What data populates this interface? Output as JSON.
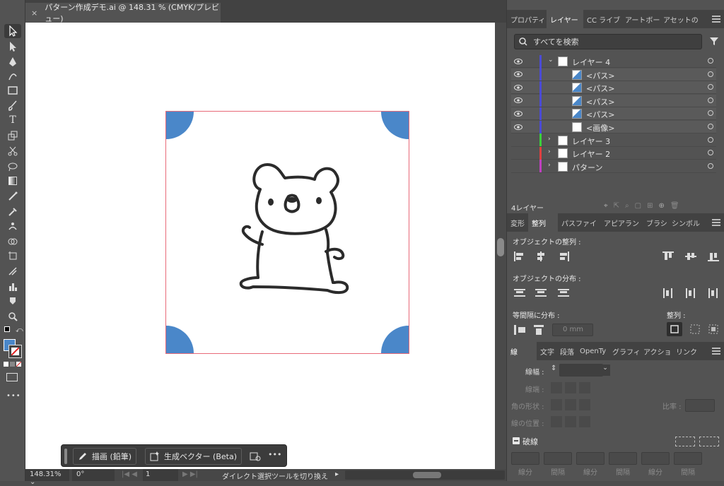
{
  "document": {
    "tab_title": "パターン作成デモ.ai @ 148.31 % (CMYK/プレビュー)",
    "close_glyph": "×"
  },
  "tools": [
    "selection-tool",
    "direct-selection-tool",
    "pen-tool",
    "curvature-tool",
    "rectangle-tool",
    "paintbrush-tool",
    "type-tool",
    "scale-tool",
    "scissors-tool",
    "lasso-tool",
    "gradient-tool",
    "eyedropper-tool",
    "blend-tool",
    "puppet-warp-tool",
    "shape-builder-tool",
    "symbol-sprayer-tool",
    "column-graph-tool",
    "live-paint-tool",
    "zoom-tool"
  ],
  "colors": {
    "accent_blue": "#4a87c9",
    "artboard_border": "#e86a78",
    "fill": "#4a87c9",
    "stroke": "none"
  },
  "statusbar": {
    "zoom": "148.31%",
    "rotation": "0°",
    "artboard_num": "1",
    "hint": "ダイレクト選択ツールを切り換え"
  },
  "floatbar": {
    "draw_label": "描画 (鉛筆)",
    "genvector_label": "生成ベクター (Beta)",
    "more": "•••"
  },
  "panel_top_tabs": [
    "プロパティ",
    "レイヤー",
    "CC ライブ",
    "アートボー",
    "アセットの"
  ],
  "layers_panel": {
    "search_placeholder": "すべてを検索",
    "rows": [
      {
        "name": "レイヤー 4",
        "kind": "layer",
        "color": "#4b4bd6",
        "expanded": true,
        "visible": true
      },
      {
        "name": "<パス>",
        "kind": "path",
        "color": "#4b4bd6",
        "visible": true
      },
      {
        "name": "<パス>",
        "kind": "path",
        "color": "#4b4bd6",
        "visible": true
      },
      {
        "name": "<パス>",
        "kind": "path",
        "color": "#4b4bd6",
        "visible": true
      },
      {
        "name": "<パス>",
        "kind": "path",
        "color": "#4b4bd6",
        "visible": true
      },
      {
        "name": "<画像>",
        "kind": "image",
        "color": "#4b4bd6",
        "visible": true
      },
      {
        "name": "レイヤー 3",
        "kind": "layer",
        "color": "#3ccf3c",
        "expanded": false,
        "visible": false
      },
      {
        "name": "レイヤー 2",
        "kind": "layer",
        "color": "#e04040",
        "expanded": false,
        "visible": false
      },
      {
        "name": "パターン",
        "kind": "layer",
        "color": "#c040c0",
        "expanded": false,
        "visible": false
      }
    ],
    "footer_count": "4レイヤー"
  },
  "panel_mid_tabs": [
    "変形",
    "整列",
    "パスファイ",
    "アピアラン",
    "ブラシ",
    "シンボル"
  ],
  "align_panel": {
    "align_objects": "オブジェクトの整列 :",
    "distribute_objects": "オブジェクトの分布 :",
    "distribute_spacing": "等間隔に分布 :",
    "align_to": "整列 :",
    "spacing_value": "0 mm"
  },
  "panel_bot_tabs": [
    "線",
    "文字",
    "段落",
    "OpenTy",
    "グラフィ",
    "アクショ",
    "リンク"
  ],
  "stroke_panel": {
    "weight_label": "線幅 :",
    "cap_label": "線端 :",
    "corner_label": "角の形状 :",
    "limit_label": "比率 :",
    "align_label": "線の位置 :",
    "dashed_label": "破線",
    "dash_labels": [
      "線分",
      "間隔",
      "線分",
      "間隔",
      "線分",
      "間隔"
    ]
  }
}
